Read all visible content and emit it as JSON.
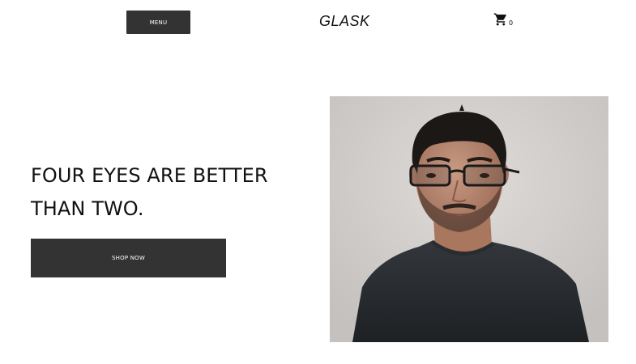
{
  "header": {
    "menu_label": "MENU",
    "brand": "GLASK",
    "cart": {
      "icon": "shopping-cart-icon",
      "count": "0"
    }
  },
  "hero": {
    "headline": "FOUR EYES ARE BETTER THAN TWO.",
    "cta_label": "SHOP NOW",
    "image": "portrait of a man wearing glasses"
  },
  "colors": {
    "button_bg": "#333333",
    "button_text": "#ffffff",
    "text": "#111111",
    "photo_bg": "#cfcccb"
  }
}
